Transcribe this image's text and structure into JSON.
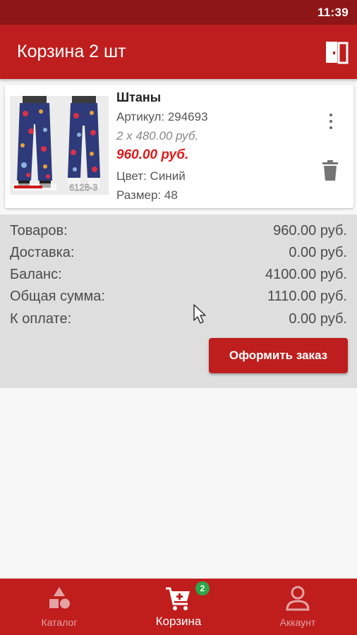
{
  "status_bar": {
    "time": "11:39"
  },
  "header": {
    "title": "Корзина 2 шт",
    "logout_icon": "door-exit-icon"
  },
  "cart_item": {
    "name": "Штаны",
    "sku": "Артикул: 294693",
    "quantity_price": "2 x 480.00 руб.",
    "total": "960.00 руб.",
    "color": "Цвет: Синий",
    "size": "Размер: 48",
    "photo_caption": "6128-3",
    "menu_icon": "more-vert-icon",
    "delete_icon": "trash-icon"
  },
  "summary": {
    "rows": [
      {
        "label": "Товаров:",
        "value": "960.00 руб."
      },
      {
        "label": "Доставка:",
        "value": "0.00 руб."
      },
      {
        "label": "Баланс:",
        "value": "4100.00 руб."
      },
      {
        "label": "Общая сумма:",
        "value": "1110.00 руб."
      },
      {
        "label": "К оплате:",
        "value": "0.00 руб."
      }
    ],
    "checkout_label": "Оформить заказ"
  },
  "bottom_nav": {
    "items": [
      {
        "label": "Каталог",
        "icon": "shapes-icon",
        "active": false
      },
      {
        "label": "Корзина",
        "icon": "cart-add-icon",
        "active": true,
        "badge": "2"
      },
      {
        "label": "Аккаунт",
        "icon": "person-icon",
        "active": false
      }
    ]
  },
  "colors": {
    "primary": "#bf1e1e",
    "status_bar": "#8e1616",
    "price_accent": "#e01b1b",
    "badge": "#2fa44a",
    "summary_bg": "#dedede"
  }
}
